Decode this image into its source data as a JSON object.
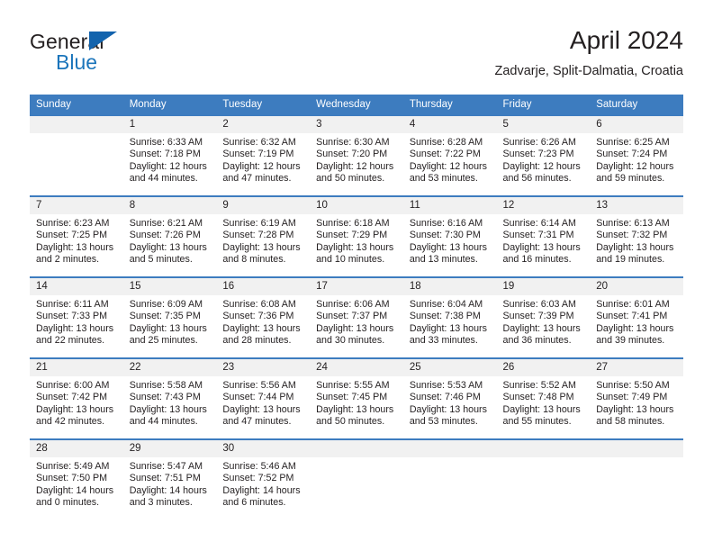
{
  "logo": {
    "word_one": "General",
    "word_two": "Blue",
    "triangle_icon": "triangle-icon",
    "brand_blue": "#1b75bb",
    "brand_dark": "#231f20"
  },
  "header": {
    "title": "April 2024",
    "subtitle": "Zadvarje, Split-Dalmatia, Croatia"
  },
  "theme": {
    "header_blue": "#3d7cbf",
    "daynum_band": "#f1f1f1",
    "text": "#231f20"
  },
  "weekday_headers": [
    "Sunday",
    "Monday",
    "Tuesday",
    "Wednesday",
    "Thursday",
    "Friday",
    "Saturday"
  ],
  "weeks": [
    [
      {
        "day": "",
        "sunrise": "",
        "sunset": "",
        "daylight_line1": "",
        "daylight_line2": ""
      },
      {
        "day": "1",
        "sunrise": "Sunrise: 6:33 AM",
        "sunset": "Sunset: 7:18 PM",
        "daylight_line1": "Daylight: 12 hours",
        "daylight_line2": "and 44 minutes."
      },
      {
        "day": "2",
        "sunrise": "Sunrise: 6:32 AM",
        "sunset": "Sunset: 7:19 PM",
        "daylight_line1": "Daylight: 12 hours",
        "daylight_line2": "and 47 minutes."
      },
      {
        "day": "3",
        "sunrise": "Sunrise: 6:30 AM",
        "sunset": "Sunset: 7:20 PM",
        "daylight_line1": "Daylight: 12 hours",
        "daylight_line2": "and 50 minutes."
      },
      {
        "day": "4",
        "sunrise": "Sunrise: 6:28 AM",
        "sunset": "Sunset: 7:22 PM",
        "daylight_line1": "Daylight: 12 hours",
        "daylight_line2": "and 53 minutes."
      },
      {
        "day": "5",
        "sunrise": "Sunrise: 6:26 AM",
        "sunset": "Sunset: 7:23 PM",
        "daylight_line1": "Daylight: 12 hours",
        "daylight_line2": "and 56 minutes."
      },
      {
        "day": "6",
        "sunrise": "Sunrise: 6:25 AM",
        "sunset": "Sunset: 7:24 PM",
        "daylight_line1": "Daylight: 12 hours",
        "daylight_line2": "and 59 minutes."
      }
    ],
    [
      {
        "day": "7",
        "sunrise": "Sunrise: 6:23 AM",
        "sunset": "Sunset: 7:25 PM",
        "daylight_line1": "Daylight: 13 hours",
        "daylight_line2": "and 2 minutes."
      },
      {
        "day": "8",
        "sunrise": "Sunrise: 6:21 AM",
        "sunset": "Sunset: 7:26 PM",
        "daylight_line1": "Daylight: 13 hours",
        "daylight_line2": "and 5 minutes."
      },
      {
        "day": "9",
        "sunrise": "Sunrise: 6:19 AM",
        "sunset": "Sunset: 7:28 PM",
        "daylight_line1": "Daylight: 13 hours",
        "daylight_line2": "and 8 minutes."
      },
      {
        "day": "10",
        "sunrise": "Sunrise: 6:18 AM",
        "sunset": "Sunset: 7:29 PM",
        "daylight_line1": "Daylight: 13 hours",
        "daylight_line2": "and 10 minutes."
      },
      {
        "day": "11",
        "sunrise": "Sunrise: 6:16 AM",
        "sunset": "Sunset: 7:30 PM",
        "daylight_line1": "Daylight: 13 hours",
        "daylight_line2": "and 13 minutes."
      },
      {
        "day": "12",
        "sunrise": "Sunrise: 6:14 AM",
        "sunset": "Sunset: 7:31 PM",
        "daylight_line1": "Daylight: 13 hours",
        "daylight_line2": "and 16 minutes."
      },
      {
        "day": "13",
        "sunrise": "Sunrise: 6:13 AM",
        "sunset": "Sunset: 7:32 PM",
        "daylight_line1": "Daylight: 13 hours",
        "daylight_line2": "and 19 minutes."
      }
    ],
    [
      {
        "day": "14",
        "sunrise": "Sunrise: 6:11 AM",
        "sunset": "Sunset: 7:33 PM",
        "daylight_line1": "Daylight: 13 hours",
        "daylight_line2": "and 22 minutes."
      },
      {
        "day": "15",
        "sunrise": "Sunrise: 6:09 AM",
        "sunset": "Sunset: 7:35 PM",
        "daylight_line1": "Daylight: 13 hours",
        "daylight_line2": "and 25 minutes."
      },
      {
        "day": "16",
        "sunrise": "Sunrise: 6:08 AM",
        "sunset": "Sunset: 7:36 PM",
        "daylight_line1": "Daylight: 13 hours",
        "daylight_line2": "and 28 minutes."
      },
      {
        "day": "17",
        "sunrise": "Sunrise: 6:06 AM",
        "sunset": "Sunset: 7:37 PM",
        "daylight_line1": "Daylight: 13 hours",
        "daylight_line2": "and 30 minutes."
      },
      {
        "day": "18",
        "sunrise": "Sunrise: 6:04 AM",
        "sunset": "Sunset: 7:38 PM",
        "daylight_line1": "Daylight: 13 hours",
        "daylight_line2": "and 33 minutes."
      },
      {
        "day": "19",
        "sunrise": "Sunrise: 6:03 AM",
        "sunset": "Sunset: 7:39 PM",
        "daylight_line1": "Daylight: 13 hours",
        "daylight_line2": "and 36 minutes."
      },
      {
        "day": "20",
        "sunrise": "Sunrise: 6:01 AM",
        "sunset": "Sunset: 7:41 PM",
        "daylight_line1": "Daylight: 13 hours",
        "daylight_line2": "and 39 minutes."
      }
    ],
    [
      {
        "day": "21",
        "sunrise": "Sunrise: 6:00 AM",
        "sunset": "Sunset: 7:42 PM",
        "daylight_line1": "Daylight: 13 hours",
        "daylight_line2": "and 42 minutes."
      },
      {
        "day": "22",
        "sunrise": "Sunrise: 5:58 AM",
        "sunset": "Sunset: 7:43 PM",
        "daylight_line1": "Daylight: 13 hours",
        "daylight_line2": "and 44 minutes."
      },
      {
        "day": "23",
        "sunrise": "Sunrise: 5:56 AM",
        "sunset": "Sunset: 7:44 PM",
        "daylight_line1": "Daylight: 13 hours",
        "daylight_line2": "and 47 minutes."
      },
      {
        "day": "24",
        "sunrise": "Sunrise: 5:55 AM",
        "sunset": "Sunset: 7:45 PM",
        "daylight_line1": "Daylight: 13 hours",
        "daylight_line2": "and 50 minutes."
      },
      {
        "day": "25",
        "sunrise": "Sunrise: 5:53 AM",
        "sunset": "Sunset: 7:46 PM",
        "daylight_line1": "Daylight: 13 hours",
        "daylight_line2": "and 53 minutes."
      },
      {
        "day": "26",
        "sunrise": "Sunrise: 5:52 AM",
        "sunset": "Sunset: 7:48 PM",
        "daylight_line1": "Daylight: 13 hours",
        "daylight_line2": "and 55 minutes."
      },
      {
        "day": "27",
        "sunrise": "Sunrise: 5:50 AM",
        "sunset": "Sunset: 7:49 PM",
        "daylight_line1": "Daylight: 13 hours",
        "daylight_line2": "and 58 minutes."
      }
    ],
    [
      {
        "day": "28",
        "sunrise": "Sunrise: 5:49 AM",
        "sunset": "Sunset: 7:50 PM",
        "daylight_line1": "Daylight: 14 hours",
        "daylight_line2": "and 0 minutes."
      },
      {
        "day": "29",
        "sunrise": "Sunrise: 5:47 AM",
        "sunset": "Sunset: 7:51 PM",
        "daylight_line1": "Daylight: 14 hours",
        "daylight_line2": "and 3 minutes."
      },
      {
        "day": "30",
        "sunrise": "Sunrise: 5:46 AM",
        "sunset": "Sunset: 7:52 PM",
        "daylight_line1": "Daylight: 14 hours",
        "daylight_line2": "and 6 minutes."
      },
      {
        "day": "",
        "sunrise": "",
        "sunset": "",
        "daylight_line1": "",
        "daylight_line2": ""
      },
      {
        "day": "",
        "sunrise": "",
        "sunset": "",
        "daylight_line1": "",
        "daylight_line2": ""
      },
      {
        "day": "",
        "sunrise": "",
        "sunset": "",
        "daylight_line1": "",
        "daylight_line2": ""
      },
      {
        "day": "",
        "sunrise": "",
        "sunset": "",
        "daylight_line1": "",
        "daylight_line2": ""
      }
    ]
  ]
}
